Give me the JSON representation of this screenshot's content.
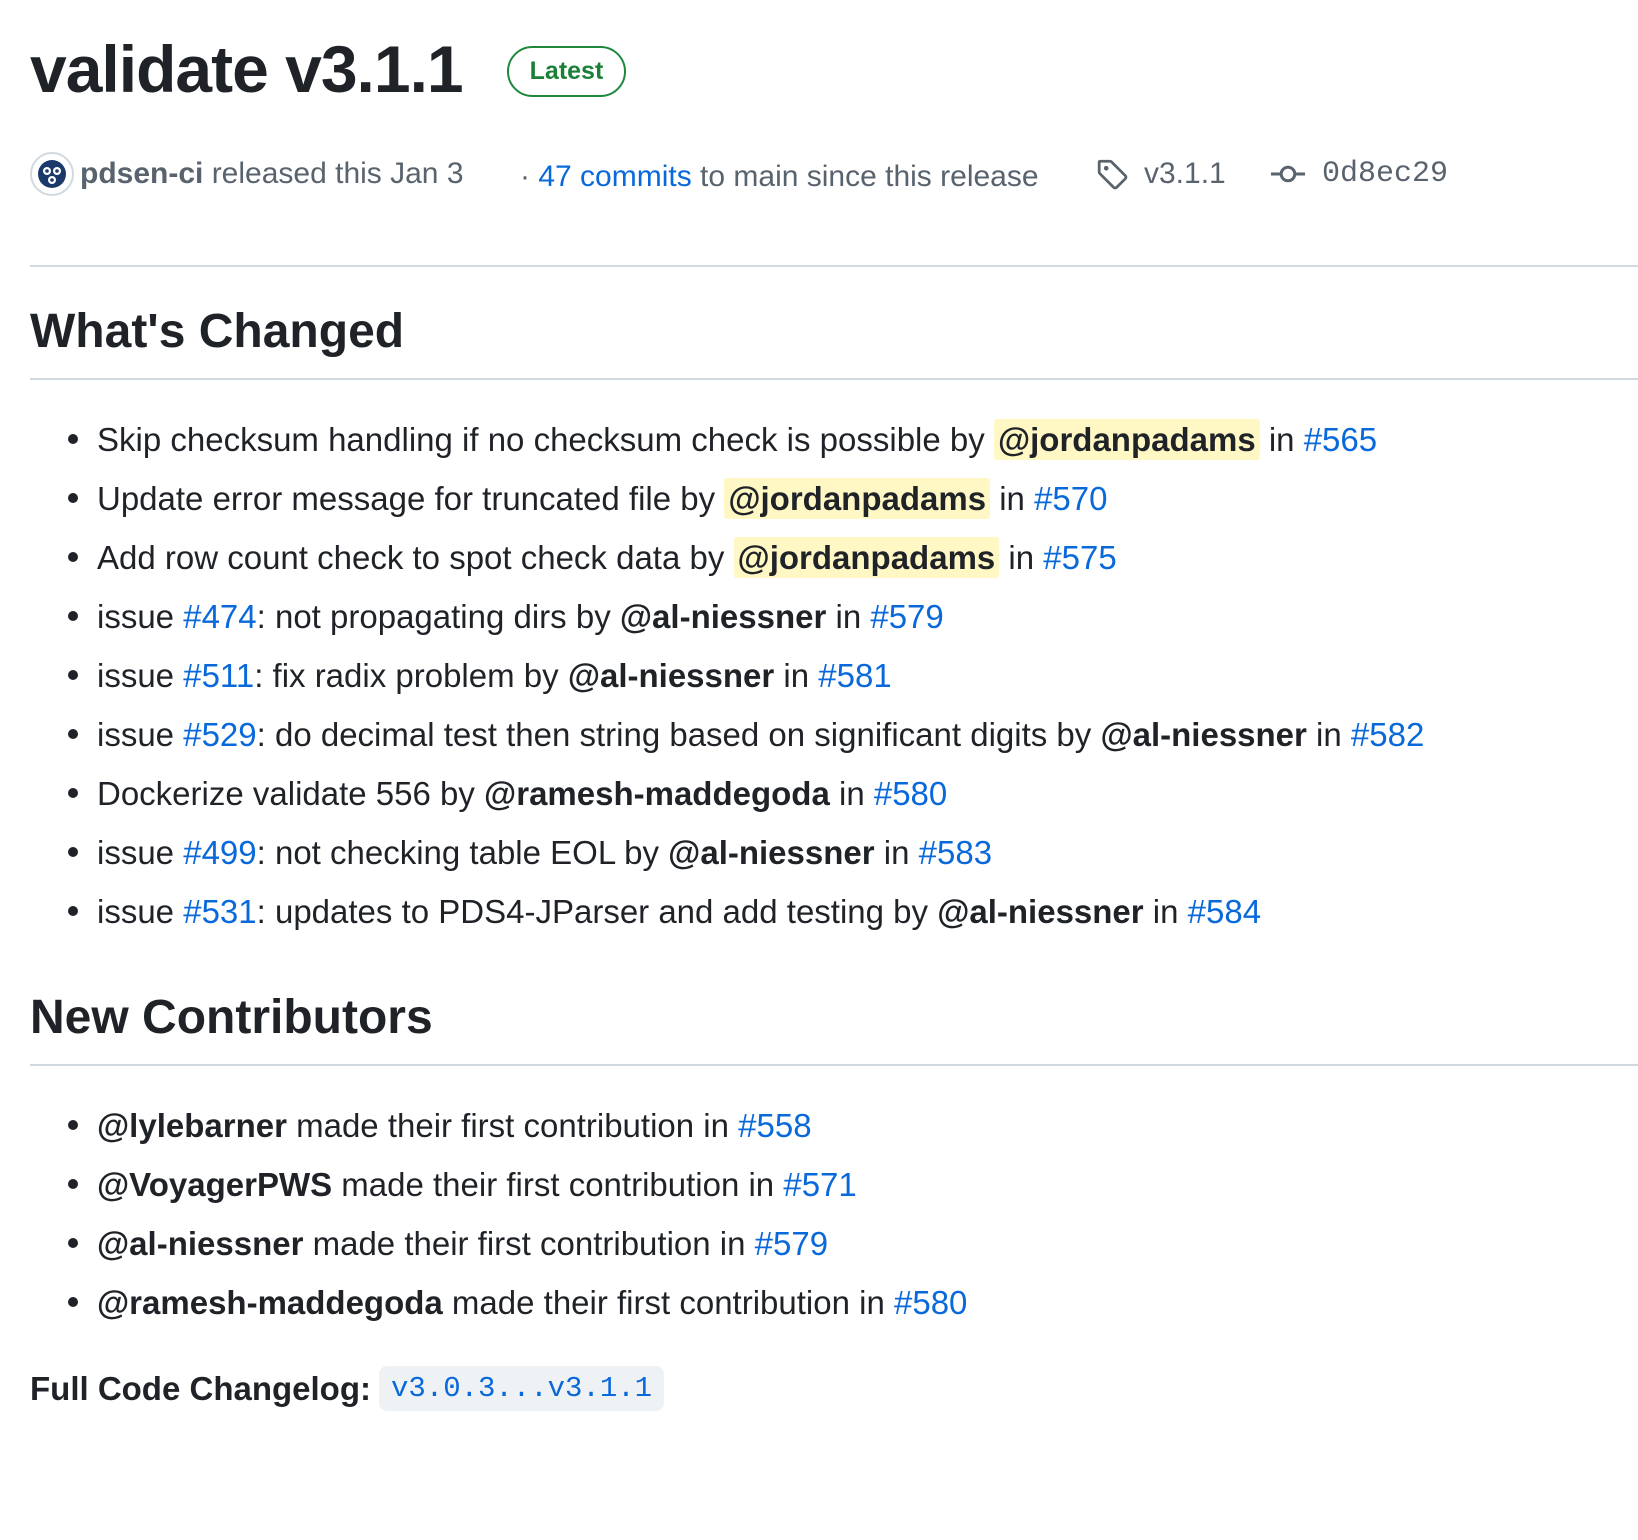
{
  "release": {
    "title": "validate v3.1.1",
    "badge": "Latest",
    "author": "pdsen-ci",
    "released_text": " released this Jan 3",
    "commits_prefix": "· ",
    "commits_link": "47 commits",
    "commits_suffix": " to main since this release",
    "tag": "v3.1.1",
    "commit_sha": "0d8ec29"
  },
  "whats_changed": {
    "heading": "What's Changed",
    "items": [
      {
        "pre": "",
        "issue": "",
        "text": "Skip checksum handling if no checksum check is possible by ",
        "user": "@jordanpadams",
        "highlight": true,
        "in": " in ",
        "pr": "#565"
      },
      {
        "pre": "",
        "issue": "",
        "text": "Update error message for truncated file by ",
        "user": "@jordanpadams",
        "highlight": true,
        "in": " in ",
        "pr": "#570"
      },
      {
        "pre": "",
        "issue": "",
        "text": "Add row count check to spot check data by ",
        "user": "@jordanpadams",
        "highlight": true,
        "in": " in ",
        "pr": "#575"
      },
      {
        "pre": "issue ",
        "issue": "#474",
        "text": ": not propagating dirs by ",
        "user": "@al-niessner",
        "highlight": false,
        "in": " in ",
        "pr": "#579"
      },
      {
        "pre": "issue ",
        "issue": "#511",
        "text": ": fix radix problem by ",
        "user": "@al-niessner",
        "highlight": false,
        "in": " in ",
        "pr": "#581"
      },
      {
        "pre": "issue ",
        "issue": "#529",
        "text": ": do decimal test then string based on significant digits by ",
        "user": "@al-niessner",
        "highlight": false,
        "in": " in ",
        "pr": "#582"
      },
      {
        "pre": "",
        "issue": "",
        "text": "Dockerize validate 556 by ",
        "user": "@ramesh-maddegoda",
        "highlight": false,
        "in": " in ",
        "pr": "#580"
      },
      {
        "pre": "issue ",
        "issue": "#499",
        "text": ": not checking table EOL by ",
        "user": "@al-niessner",
        "highlight": false,
        "in": " in ",
        "pr": "#583"
      },
      {
        "pre": "issue ",
        "issue": "#531",
        "text": ": updates to PDS4-JParser and add testing by ",
        "user": "@al-niessner",
        "highlight": false,
        "in": " in ",
        "pr": "#584"
      }
    ]
  },
  "new_contributors": {
    "heading": "New Contributors",
    "items": [
      {
        "user": "@lylebarner",
        "text": " made their first contribution in ",
        "pr": "#558"
      },
      {
        "user": "@VoyagerPWS",
        "text": " made their first contribution in ",
        "pr": "#571"
      },
      {
        "user": "@al-niessner",
        "text": " made their first contribution in ",
        "pr": "#579"
      },
      {
        "user": "@ramesh-maddegoda",
        "text": " made their first contribution in ",
        "pr": "#580"
      }
    ]
  },
  "changelog": {
    "label": "Full Code Changelog:",
    "range": "v3.0.3...v3.1.1"
  },
  "icons": {
    "avatar": "octocat-avatar-icon",
    "tag": "tag-icon",
    "commit": "git-commit-icon"
  },
  "colors": {
    "link": "#0969da",
    "badge_green": "#1a7f37",
    "highlight": "#fff8c5",
    "text": "#1f2328",
    "muted": "#59636e"
  }
}
